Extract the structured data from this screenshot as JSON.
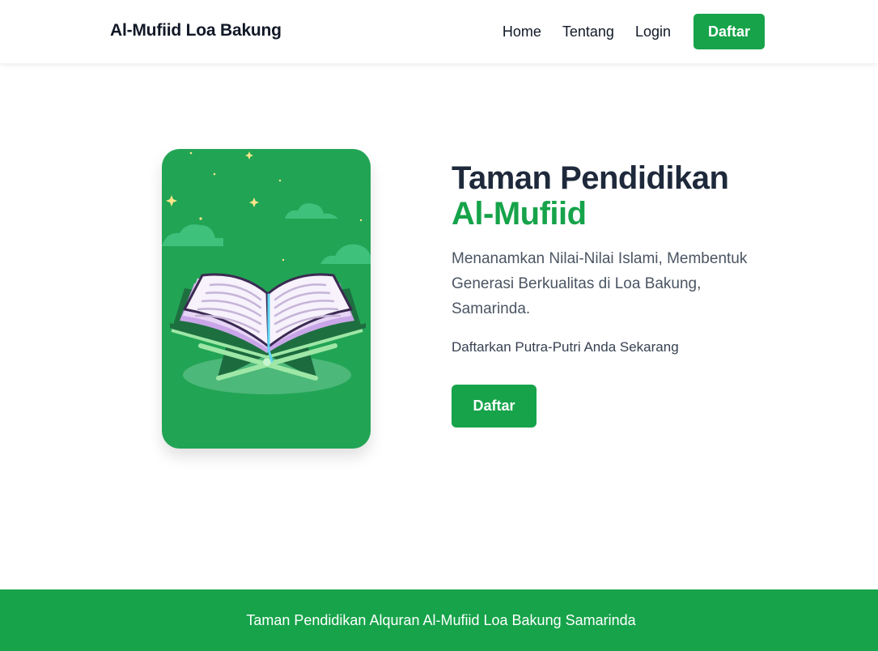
{
  "navbar": {
    "brand": "Al-Mufiid Loa Bakung",
    "links": [
      "Home",
      "Tentang",
      "Login"
    ],
    "cta_label": "Daftar"
  },
  "hero": {
    "title_line1": "Taman Pendidikan",
    "title_line2": "Al-Mufiid",
    "subtitle": "Menanamkan Nilai-Nilai Islami, Membentuk Generasi Berkualitas di Loa Bakung, Samarinda.",
    "cta_text": "Daftarkan Putra-Putri Anda Sekarang",
    "button_label": "Daftar",
    "illustration": "open-quran-on-rehal-illustration"
  },
  "footer": {
    "text": "Taman Pendidikan Alquran Al-Mufiid Loa Bakung Samarinda"
  },
  "colors": {
    "primary": "#16a34a",
    "card_bg": "#22a455",
    "title": "#1e293b",
    "text_muted": "#4b5563"
  }
}
